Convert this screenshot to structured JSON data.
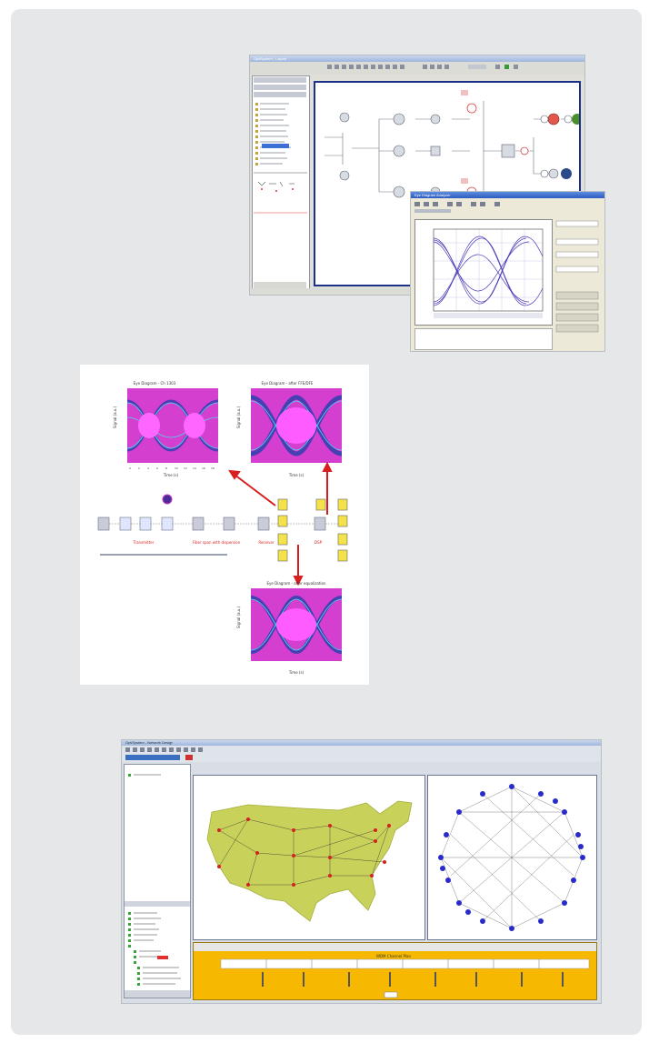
{
  "figure1": {
    "main_window": {
      "title": "OptiSystem - Layout"
    },
    "eye_window": {
      "title": "Eye Diagram Analyzer"
    }
  },
  "figure2": {
    "plots": [
      {
        "title": "Eye Diagram - Ch 1303",
        "xlabel": "Time (s)",
        "ylabel": "Signal (a.u.)"
      },
      {
        "title": "Eye Diagram - after FFE/DFE",
        "xlabel": "Time (s)",
        "ylabel": "Signal (a.u.)"
      },
      {
        "title": "Eye Diagram - after equalization",
        "xlabel": "Time (s)",
        "ylabel": "Signal (a.u.)"
      }
    ],
    "labels": {
      "tx": "Transmitter",
      "fiber": "Fiber span with dispersion",
      "rx": "Receiver",
      "dsp": "DSP"
    }
  },
  "figure3": {
    "title": "OptiSystem - Network Design",
    "map": {
      "fill": "#c8d25a",
      "node_color": "#d82020"
    },
    "graph": {
      "node_color": "#2a2acb",
      "node_count": 20
    },
    "bottom_panel": {
      "title": "WDM Channel Plan",
      "accent": "#f6b800"
    }
  }
}
